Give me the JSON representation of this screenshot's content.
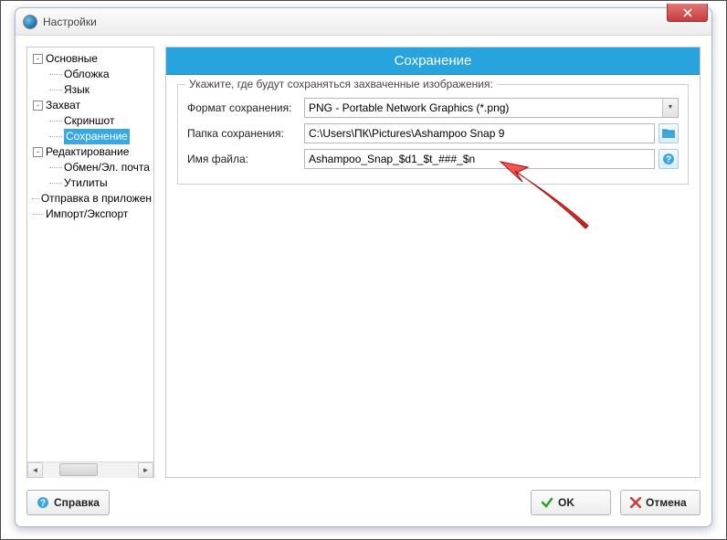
{
  "window": {
    "title": "Настройки"
  },
  "tree": {
    "items": [
      {
        "label": "Основные",
        "depth": 0,
        "toggle": "-"
      },
      {
        "label": "Обложка",
        "depth": 1
      },
      {
        "label": "Язык",
        "depth": 1
      },
      {
        "label": "Захват",
        "depth": 0,
        "toggle": "-"
      },
      {
        "label": "Скриншот",
        "depth": 1
      },
      {
        "label": "Сохранение",
        "depth": 1,
        "selected": true
      },
      {
        "label": "Редактирование",
        "depth": 0,
        "toggle": "-"
      },
      {
        "label": "Обмен/Эл. почта",
        "depth": 1
      },
      {
        "label": "Утилиты",
        "depth": 1
      },
      {
        "label": "Отправка в приложен",
        "depth": 0,
        "leaf": true
      },
      {
        "label": "Импорт/Экспорт",
        "depth": 0,
        "leaf": true
      }
    ]
  },
  "panel": {
    "title": "Сохранение",
    "group_legend": "Укажите, где будут сохраняться захваченные изображения:",
    "rows": {
      "format_label": "Формат сохранения:",
      "format_value": "PNG - Portable Network Graphics (*.png)",
      "folder_label": "Папка сохранения:",
      "folder_value": "C:\\Users\\ПК\\Pictures\\Ashampoo Snap 9",
      "filename_label": "Имя файла:",
      "filename_value": "Ashampoo_Snap_$d1_$t_###_$n"
    }
  },
  "footer": {
    "help": "Справка",
    "ok": "OK",
    "cancel": "Отмена"
  }
}
